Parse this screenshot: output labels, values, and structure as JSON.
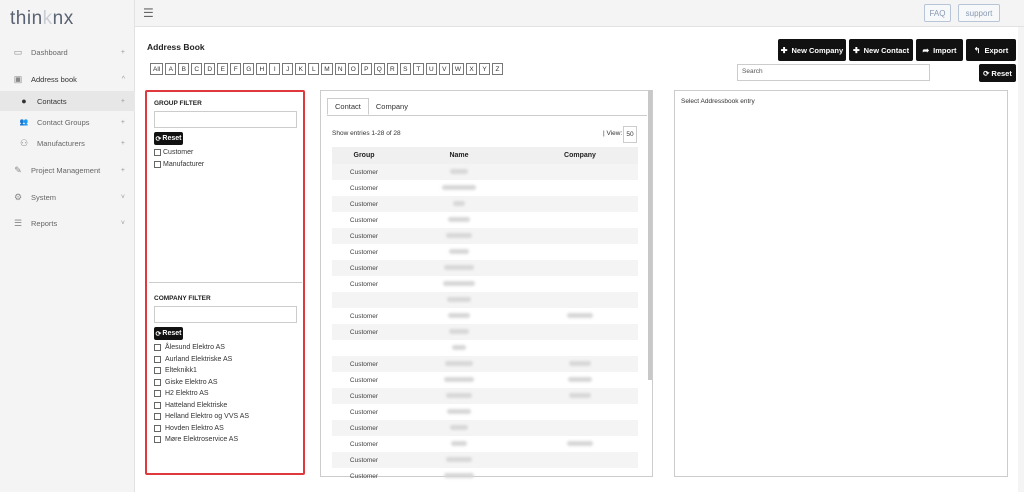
{
  "logo": {
    "pre": "thin",
    "k": "k",
    "post": "nx"
  },
  "sidebar": {
    "items": [
      {
        "label": "Dashboard",
        "icon": "dashboard-icon",
        "glyph": "▭",
        "arrow": "+"
      },
      {
        "label": "Address book",
        "icon": "address-book-icon",
        "glyph": "▣",
        "arrow": "^"
      },
      {
        "label": "Contacts",
        "icon": "user-icon",
        "glyph": "●",
        "arrow": "+"
      },
      {
        "label": "Contact Groups",
        "icon": "users-icon",
        "glyph": "👥",
        "arrow": "+"
      },
      {
        "label": "Manufacturers",
        "icon": "manufacturers-icon",
        "glyph": "⚇",
        "arrow": "+"
      },
      {
        "label": "Project Management",
        "icon": "project-icon",
        "glyph": "✎",
        "arrow": "+"
      },
      {
        "label": "System",
        "icon": "system-icon",
        "glyph": "⚙",
        "arrow": "˅"
      },
      {
        "label": "Reports",
        "icon": "reports-icon",
        "glyph": "☰",
        "arrow": "˅"
      }
    ]
  },
  "topbar": {
    "faq": "FAQ",
    "support": "support",
    "menu_glyph": "☰"
  },
  "page": {
    "title": "Address Book"
  },
  "letters": [
    "All",
    "A",
    "B",
    "C",
    "D",
    "E",
    "F",
    "G",
    "H",
    "I",
    "J",
    "K",
    "L",
    "M",
    "N",
    "O",
    "P",
    "Q",
    "R",
    "S",
    "T",
    "U",
    "V",
    "W",
    "X",
    "Y",
    "Z"
  ],
  "actions": {
    "new_company": "New Company",
    "new_contact": "New Contact",
    "import": "Import",
    "export": "Export",
    "reset": "Reset",
    "search_placeholder": "Search"
  },
  "group_filter": {
    "title": "GROUP FILTER",
    "reset": "Reset",
    "items": [
      "Customer",
      "Manufacturer"
    ]
  },
  "company_filter": {
    "title": "COMPANY FILTER",
    "reset": "Reset",
    "items": [
      "Ålesund Elektro AS",
      "Aurland Elektriske AS",
      "Elteknikk1",
      "Giske Elektro AS",
      "H2 Elektro AS",
      "Hatteland Elektriske",
      "Helland Elektro og VVS AS",
      "Hovden Elektro AS",
      "Møre Elektroservice AS"
    ]
  },
  "contacts_panel": {
    "tabs": [
      "Contact",
      "Company"
    ],
    "show_entries": "Show entries 1-28 of 28",
    "view_label": "| View:",
    "view_value": "50",
    "columns": [
      "Group",
      "Name",
      "Company"
    ],
    "rows": [
      {
        "group": "Customer",
        "name": "",
        "company": ""
      },
      {
        "group": "Customer",
        "name": "",
        "company": ""
      },
      {
        "group": "Customer",
        "name": "",
        "company": ""
      },
      {
        "group": "Customer",
        "name": "",
        "company": ""
      },
      {
        "group": "Customer",
        "name": "",
        "company": ""
      },
      {
        "group": "Customer",
        "name": "",
        "company": ""
      },
      {
        "group": "Customer",
        "name": "",
        "company": ""
      },
      {
        "group": "Customer",
        "name": "",
        "company": ""
      },
      {
        "group": "",
        "name": "",
        "company": ""
      },
      {
        "group": "Customer",
        "name": "",
        "company": ""
      },
      {
        "group": "Customer",
        "name": "",
        "company": ""
      },
      {
        "group": "",
        "name": "",
        "company": ""
      },
      {
        "group": "Customer",
        "name": "",
        "company": ""
      },
      {
        "group": "Customer",
        "name": "",
        "company": ""
      },
      {
        "group": "Customer",
        "name": "",
        "company": ""
      },
      {
        "group": "Customer",
        "name": "",
        "company": ""
      },
      {
        "group": "Customer",
        "name": "",
        "company": ""
      },
      {
        "group": "Customer",
        "name": "",
        "company": ""
      },
      {
        "group": "Customer",
        "name": "",
        "company": ""
      },
      {
        "group": "Customer",
        "name": "",
        "company": ""
      }
    ]
  },
  "detail_panel": {
    "label": "Select Addressbook entry"
  }
}
